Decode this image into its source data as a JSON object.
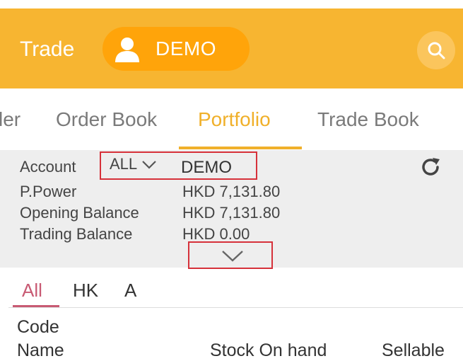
{
  "header": {
    "title": "Trade",
    "account_pill": "DEMO",
    "avatar_icon": "user-icon",
    "search_icon": "search-icon",
    "background": "#f7b531",
    "pill_color": "#ffa40a"
  },
  "tabs": [
    {
      "label": "ler"
    },
    {
      "label": "Order Book"
    },
    {
      "label": "Portfolio",
      "active": true
    },
    {
      "label": "Trade Book"
    }
  ],
  "account_panel": {
    "account_label": "Account",
    "account_select": "ALL",
    "account_name": "DEMO",
    "rows": [
      {
        "label": "P.Power",
        "value": "HKD 7,131.80"
      },
      {
        "label": "Opening Balance",
        "value": "HKD 7,131.80"
      },
      {
        "label": "Trading Balance",
        "value": "HKD 0.00"
      }
    ],
    "refresh_icon": "refresh-icon",
    "expand_icon": "chevron-down-icon"
  },
  "market_tabs": [
    {
      "label": "All",
      "active": true
    },
    {
      "label": "HK"
    },
    {
      "label": "A"
    }
  ],
  "columns": {
    "code": "Code",
    "name": "Name",
    "stock_on_hand": "Stock On hand",
    "sellable": "Sellable"
  }
}
